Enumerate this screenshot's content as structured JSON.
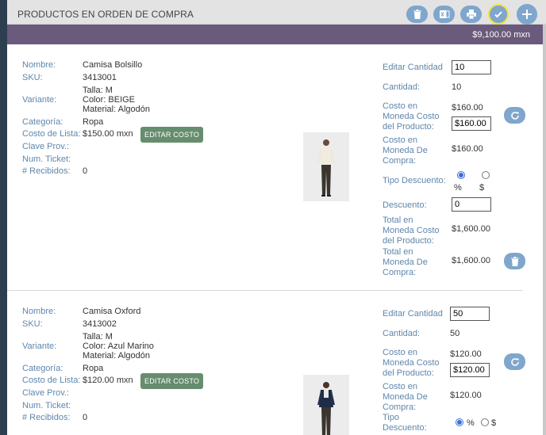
{
  "header": {
    "title": "PRODUCTOS EN ORDEN DE COMPRA",
    "total": "$9,100.00 mxn"
  },
  "labels": {
    "nombre": "Nombre:",
    "sku": "SKU:",
    "variante": "Variante:",
    "categoria": "Categoría:",
    "costo_lista": "Costo de Lista:",
    "clave_prov": "Clave Prov.:",
    "num_ticket": "Num. Ticket:",
    "recibidos": "# Recibidos:",
    "editar_costo": "EDITAR COSTO",
    "editar_cantidad": "Editar Cantidad",
    "cantidad": "Cantidad:",
    "costo_moneda_producto": "Costo en Moneda Costo del Producto:",
    "costo_moneda_compra": "Costo en Moneda De Compra:",
    "tipo_descuento": "Tipo Descuento:",
    "tipo_descuento_2": "Tipo Descuento:",
    "pct": "%",
    "dollar": "$",
    "descuento": "Descuento:",
    "total_moneda_producto": "Total en Moneda Costo del Producto:",
    "total_moneda_compra": "Total en Moneda De Compra:"
  },
  "products": [
    {
      "nombre": "Camisa Bolsillo",
      "sku": "3413001",
      "talla": "Talla: M",
      "color": "Color: BEIGE",
      "material": "Material: Algodón",
      "categoria": "Ropa",
      "costo_lista": "$150.00 mxn",
      "recibidos": "0",
      "editar_cantidad": "10",
      "cantidad": "10",
      "costo_moneda_producto": "$160.00",
      "costo_moneda_producto_input": "$160.00",
      "costo_moneda_compra": "$160.00",
      "descuento": "0",
      "total_moneda_producto": "$1,600.00",
      "total_moneda_compra": "$1,600.00"
    },
    {
      "nombre": "Camisa Oxford",
      "sku": "3413002",
      "talla": "Talla: M",
      "color": "Color: Azul Marino",
      "material": "Material: Algodón",
      "categoria": "Ropa",
      "costo_lista": "$120.00 mxn",
      "recibidos": "0",
      "editar_cantidad": "50",
      "cantidad": "50",
      "costo_moneda_producto": "$120.00",
      "costo_moneda_producto_input": "$120.00",
      "costo_moneda_compra": "$120.00"
    }
  ],
  "icons": {
    "delete": "trash-icon",
    "excel": "excel-icon",
    "print": "printer-icon",
    "confirm": "check-icon",
    "add": "plus-icon",
    "refresh": "refresh-icon"
  }
}
